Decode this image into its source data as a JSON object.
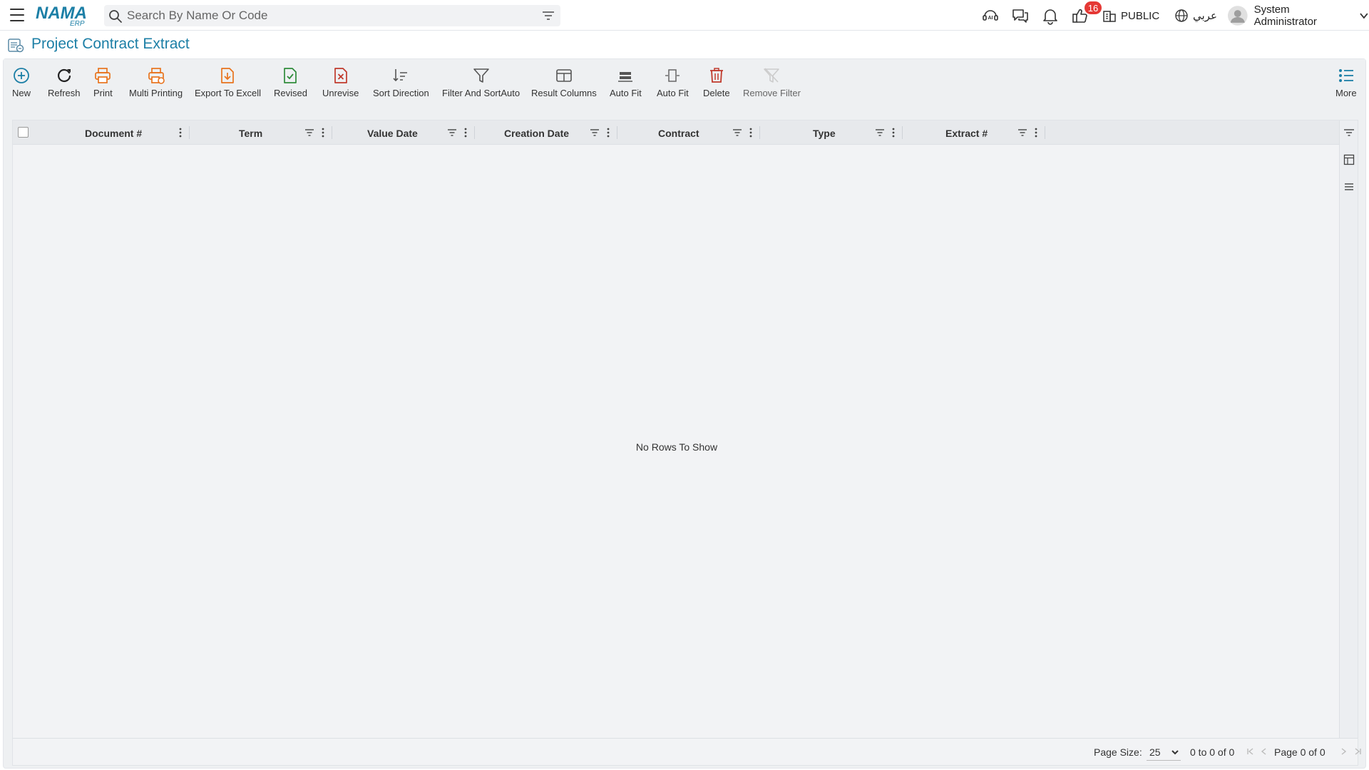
{
  "app": {
    "logo_text": "NAMA",
    "logo_sub": "ERP"
  },
  "search": {
    "placeholder": "Search By Name Or Code"
  },
  "header": {
    "notification_badge": "16",
    "branch_label": "PUBLIC",
    "language_label": "عربي",
    "user_name": "System Administrator"
  },
  "page": {
    "title": "Project Contract Extract"
  },
  "toolbar": {
    "new": "New",
    "refresh": "Refresh",
    "print": "Print",
    "multi_printing": "Multi Printing",
    "export_excel": "Export To Excell",
    "revised": "Revised",
    "unrevise": "Unrevise",
    "sort_direction": "Sort Direction",
    "filter_sort_auto": "Filter And SortAuto",
    "result_columns": "Result Columns",
    "auto_fit_1": "Auto Fit",
    "auto_fit_2": "Auto Fit",
    "delete": "Delete",
    "remove_filter": "Remove Filter",
    "more": "More"
  },
  "grid": {
    "columns": {
      "document": "Document #",
      "term": "Term",
      "value_date": "Value Date",
      "creation_date": "Creation Date",
      "contract": "Contract",
      "type": "Type",
      "extract": "Extract #"
    },
    "empty_message": "No Rows To Show"
  },
  "pagination": {
    "page_size_label": "Page Size:",
    "page_size_value": "25",
    "range_text": "0 to 0 of 0",
    "page_text": "Page 0 of 0"
  },
  "colors": {
    "accent": "#1c7fa6",
    "orange": "#e8731d",
    "green": "#2e8b3a",
    "red": "#c0392b",
    "badge": "#e53935"
  }
}
